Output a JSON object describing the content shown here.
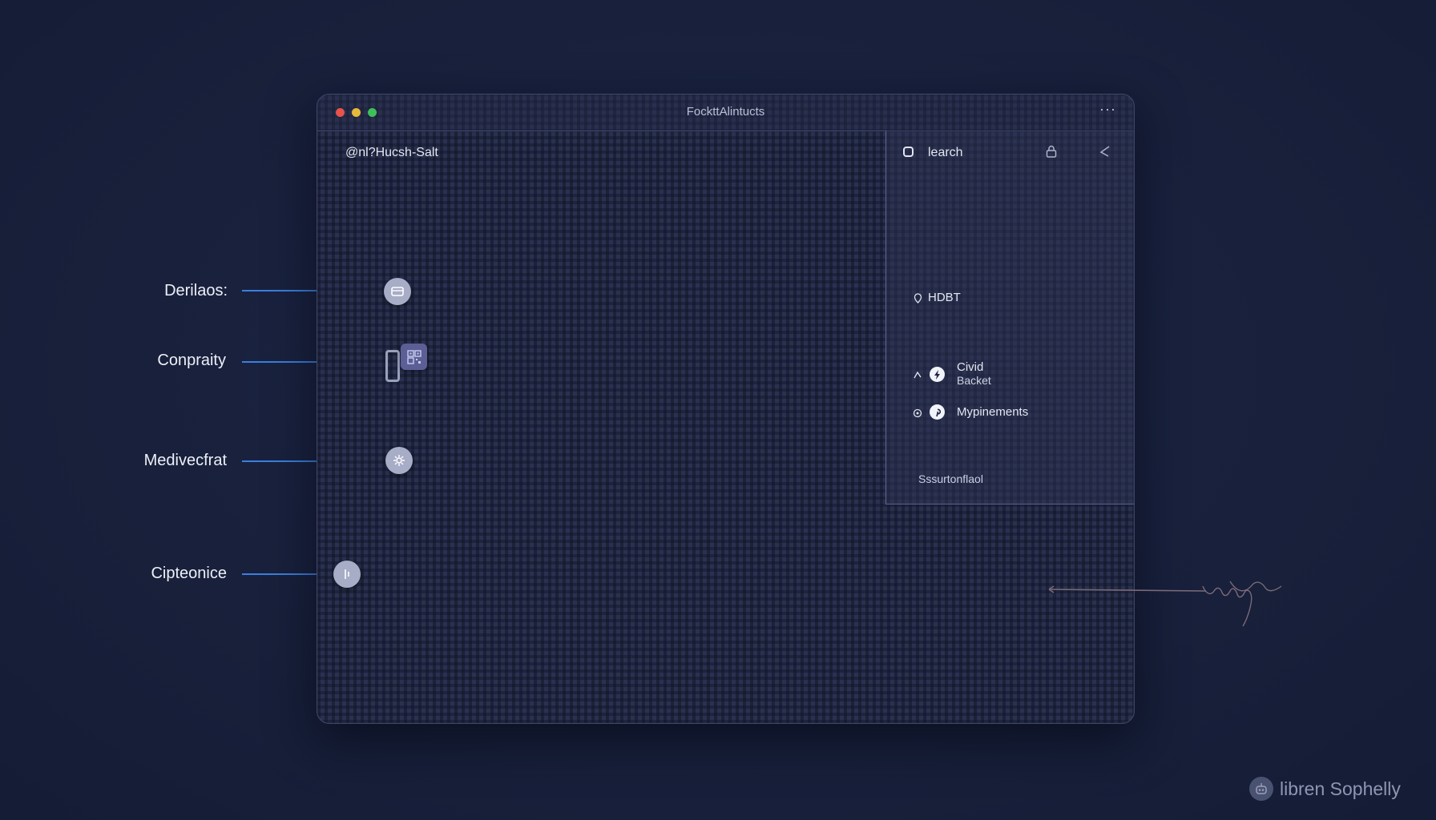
{
  "window": {
    "title": "FockttAlintucts",
    "menu_icon": "more-horizontal-icon",
    "breadcrumb": "@nl?Hucsh-Salt"
  },
  "panel": {
    "header_label": "learch",
    "header_icon": "square-icon",
    "lock_icon": "lock-icon",
    "close_icon": "collapse-icon",
    "items": [
      {
        "label": "HDBT",
        "icon": "pin-icon"
      },
      {
        "label_line1": "Civid",
        "label_line2": "Backet",
        "icon": "bolt-icon",
        "left_icon": "arrow-icon"
      },
      {
        "label": "Mypinements",
        "icon": "pinterest-icon",
        "left_icon": "circle-icon"
      }
    ],
    "status": "Sssurtonflaol"
  },
  "callouts": [
    {
      "label": "Derilaos:"
    },
    {
      "label": "Conpraity"
    },
    {
      "label": "Medivecfrat"
    },
    {
      "label": "Cipteonice"
    }
  ],
  "annotation": {
    "text": "bsmuy noch"
  },
  "brand": {
    "name": "libren Sophelly",
    "icon": "robot-icon"
  },
  "colors": {
    "background": "#19213d",
    "accent_line": "#3a7fe0",
    "traffic_red": "#e5534b",
    "traffic_yellow": "#e6b73c",
    "traffic_green": "#3fbf5b"
  }
}
